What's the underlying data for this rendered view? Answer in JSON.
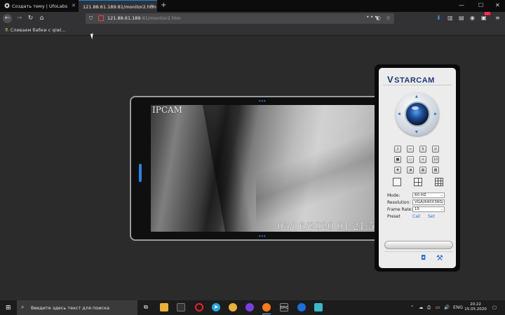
{
  "browser": {
    "tabs": [
      {
        "label": "Создать тему | UfoLabs - Лабо",
        "active": false
      },
      {
        "label": "121.88.61.189:81/monitor2.htm",
        "active": true
      }
    ],
    "new_tab": "+",
    "window_controls": {
      "minimize": "—",
      "maximize": "☐",
      "close": "✕"
    },
    "url": {
      "host": "121.88.61.189",
      "rest": ":81/monitor2.htm"
    },
    "menu_dots": "•••",
    "bookmarks": [
      {
        "label": "Сливаем бабки с qiwi..."
      }
    ],
    "addon_badge": "115"
  },
  "viewer": {
    "camera_name": "IPCAM",
    "timestamp": "05/16/2020 01:21:58"
  },
  "panel": {
    "brand": "STARCAM",
    "mode_label": "Mode:",
    "mode_value": "60 HZ",
    "resolution_label": "Resolution:",
    "resolution_value": "VGA(640X360)",
    "framerate_label": "Frame Rate:",
    "framerate_value": "15",
    "preset_label": "Preset",
    "preset_call": "Call",
    "preset_set": "Set",
    "icons_row1": [
      "1",
      "2",
      "3",
      "4"
    ],
    "icons_row2": [
      "5",
      "6",
      "7",
      "10"
    ],
    "icons_row3": [
      "8",
      "9",
      "11",
      "12"
    ]
  },
  "taskbar": {
    "search_placeholder": "Введите здесь текст для поиска",
    "lang": "ENG",
    "time": "20:22",
    "date": "15.05.2020"
  },
  "colors": {
    "accent": "#0a84ff",
    "brand": "#1a3a7a",
    "link": "#2d6bd0"
  }
}
